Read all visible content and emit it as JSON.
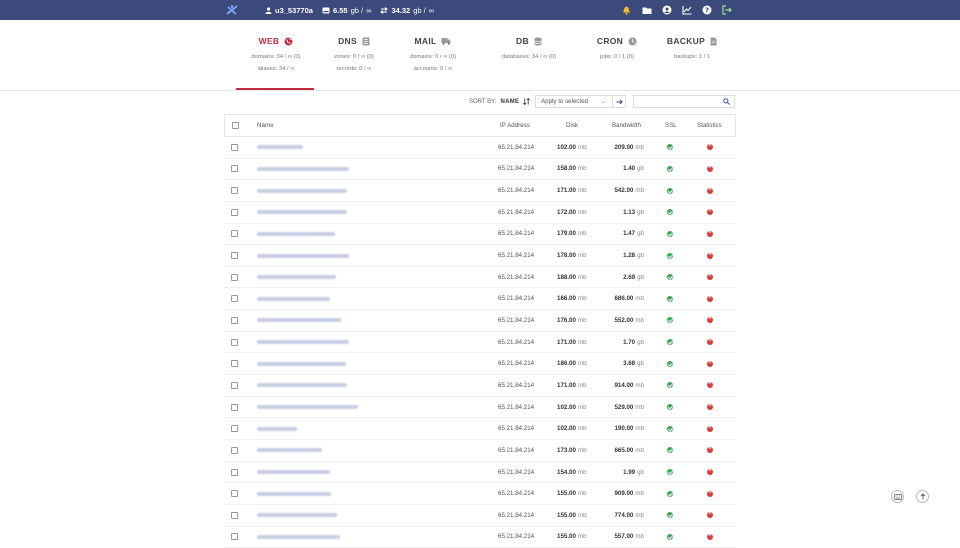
{
  "topbar": {
    "user": "u3_53770a",
    "disk": "6.55",
    "disk_unit": "gb /",
    "disk_limit": "∞",
    "bandwidth": "34.32",
    "bandwidth_unit": "gb /",
    "bandwidth_limit": "∞"
  },
  "tabs": [
    {
      "label": "WEB",
      "line1": "domains: 34 / ∞ (0)",
      "line2": "aliases: 34 / ∞"
    },
    {
      "label": "DNS",
      "line1": "zones: 0 / ∞ (0)",
      "line2": "records: 0 / ∞"
    },
    {
      "label": "MAIL",
      "line1": "domains: 0 / ∞ (0)",
      "line2": "accounts: 0 / ∞"
    },
    {
      "label": "DB",
      "line1": "databases: 34 / ∞ (0)",
      "line2": ""
    },
    {
      "label": "CRON",
      "line1": "jobs: 0 / 1 (0)",
      "line2": ""
    },
    {
      "label": "BACKUP",
      "line1": "backups: 1 / 1",
      "line2": ""
    }
  ],
  "toolbar": {
    "sort_label": "SORT BY:",
    "sort_value": "NAME",
    "apply_label": "Apply to selected",
    "search_placeholder": ""
  },
  "table": {
    "headers": {
      "name": "Name",
      "ip": "IP Address",
      "disk": "Disk",
      "bandwidth": "Bandwidth",
      "ssl": "SSL",
      "stats": "Statistics"
    },
    "rows": [
      {
        "ip": "65.21.84.214",
        "disk": "102.00",
        "disk_unit": "mb",
        "bw": "209.00",
        "bw_unit": "mb",
        "name_w": 0.39
      },
      {
        "ip": "65.21.84.214",
        "disk": "158.00",
        "disk_unit": "mb",
        "bw": "1.40",
        "bw_unit": "gb",
        "name_w": 0.78
      },
      {
        "ip": "65.21.84.214",
        "disk": "171.00",
        "disk_unit": "mb",
        "bw": "542.00",
        "bw_unit": "mb",
        "name_w": 0.76
      },
      {
        "ip": "65.21.84.214",
        "disk": "172.00",
        "disk_unit": "mb",
        "bw": "1.13",
        "bw_unit": "gb",
        "name_w": 0.76
      },
      {
        "ip": "65.21.84.214",
        "disk": "179.00",
        "disk_unit": "mb",
        "bw": "1.47",
        "bw_unit": "gb",
        "name_w": 0.66
      },
      {
        "ip": "65.21.84.214",
        "disk": "178.00",
        "disk_unit": "mb",
        "bw": "1.28",
        "bw_unit": "gb",
        "name_w": 0.78
      },
      {
        "ip": "65.21.84.214",
        "disk": "188.00",
        "disk_unit": "mb",
        "bw": "2.69",
        "bw_unit": "gb",
        "name_w": 0.67
      },
      {
        "ip": "65.21.84.214",
        "disk": "166.00",
        "disk_unit": "mb",
        "bw": "686.00",
        "bw_unit": "mb",
        "name_w": 0.62
      },
      {
        "ip": "65.21.84.214",
        "disk": "176.00",
        "disk_unit": "mb",
        "bw": "552.00",
        "bw_unit": "mb",
        "name_w": 0.71
      },
      {
        "ip": "65.21.84.214",
        "disk": "171.00",
        "disk_unit": "mb",
        "bw": "1.70",
        "bw_unit": "gb",
        "name_w": 0.78
      },
      {
        "ip": "65.21.84.214",
        "disk": "186.00",
        "disk_unit": "mb",
        "bw": "3.68",
        "bw_unit": "gb",
        "name_w": 0.75
      },
      {
        "ip": "65.21.84.214",
        "disk": "171.00",
        "disk_unit": "mb",
        "bw": "914.00",
        "bw_unit": "mb",
        "name_w": 0.76
      },
      {
        "ip": "65.21.84.214",
        "disk": "102.00",
        "disk_unit": "mb",
        "bw": "529.00",
        "bw_unit": "mb",
        "name_w": 0.86
      },
      {
        "ip": "65.21.84.214",
        "disk": "102.00",
        "disk_unit": "mb",
        "bw": "190.00",
        "bw_unit": "mb",
        "name_w": 0.34
      },
      {
        "ip": "65.21.84.214",
        "disk": "173.00",
        "disk_unit": "mb",
        "bw": "665.00",
        "bw_unit": "mb",
        "name_w": 0.55
      },
      {
        "ip": "65.21.84.214",
        "disk": "154.00",
        "disk_unit": "mb",
        "bw": "1.99",
        "bw_unit": "gb",
        "name_w": 0.62
      },
      {
        "ip": "65.21.84.214",
        "disk": "155.00",
        "disk_unit": "mb",
        "bw": "909.00",
        "bw_unit": "mb",
        "name_w": 0.63
      },
      {
        "ip": "65.21.84.214",
        "disk": "155.00",
        "disk_unit": "mb",
        "bw": "774.00",
        "bw_unit": "mb",
        "name_w": 0.68
      },
      {
        "ip": "65.21.84.214",
        "disk": "155.00",
        "disk_unit": "mb",
        "bw": "557.00",
        "bw_unit": "mb",
        "name_w": 0.7
      }
    ]
  },
  "colors": {
    "topbar": "#3b4a7a",
    "accent": "#c42b42",
    "ssl_ok": "#3aa655",
    "stats_off": "#d93b3b"
  }
}
